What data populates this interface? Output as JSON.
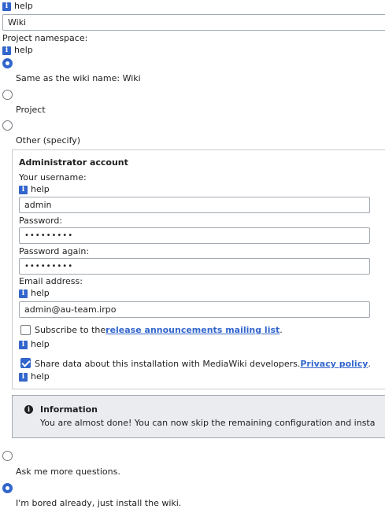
{
  "help_label": "help",
  "wiki_name": {
    "value": "Wiki"
  },
  "namespace": {
    "label": "Project namespace:",
    "options": [
      {
        "label": "Same as the wiki name: Wiki",
        "checked": true
      },
      {
        "label": "Project",
        "checked": false
      },
      {
        "label": "Other (specify)",
        "checked": false
      }
    ]
  },
  "admin": {
    "legend": "Administrator account",
    "username_label": "Your username:",
    "username_value": "admin",
    "password_label": "Password:",
    "password_value": "•••••••••",
    "password_again_label": "Password again:",
    "password_again_value": "•••••••••",
    "email_label": "Email address:",
    "email_value": "admin@au-team.irpo",
    "subscribe_prefix": "Subscribe to the",
    "subscribe_link": "release announcements mailing list",
    "subscribe_suffix": ".",
    "subscribe_checked": false,
    "share_text": "Share data about this installation with MediaWiki developers.",
    "share_link": "Privacy policy",
    "share_suffix": ".",
    "share_checked": true
  },
  "info": {
    "title": "Information",
    "text": "You are almost done! You can now skip the remaining configuration and insta"
  },
  "finish_options": [
    {
      "label": "Ask me more questions.",
      "checked": false
    },
    {
      "label": "I'm bored already, just install the wiki.",
      "checked": true
    }
  ],
  "colors": {
    "accent": "#3366cc",
    "border": "#a2a9b1",
    "notice_bg": "#eaecf0"
  }
}
